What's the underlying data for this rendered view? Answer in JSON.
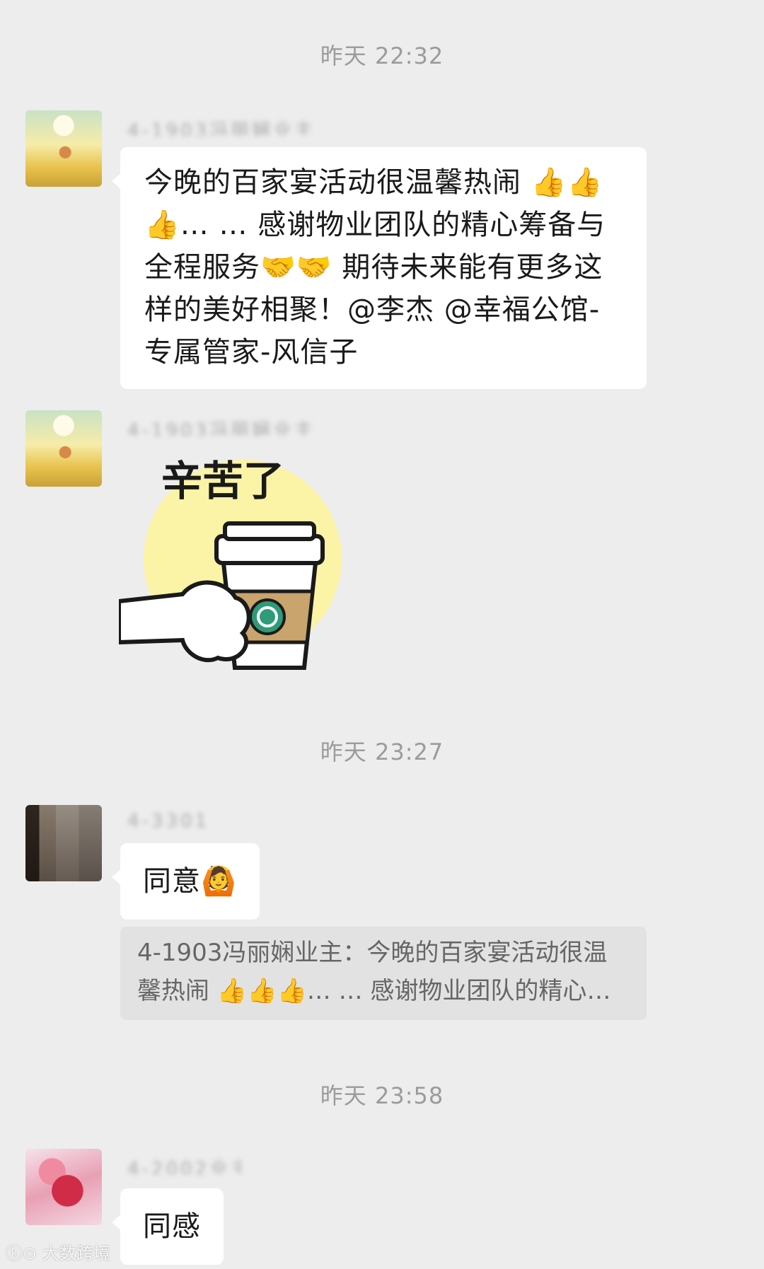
{
  "messages": [
    {
      "time": "昨天 22:32",
      "sender": "4-1903冯丽娴业主",
      "text": "今晚的百家宴活动很温馨热闹 👍👍👍… … 感谢物业团队的精心筹备与全程服务🤝🤝 期待未来能有更多这样的美好相聚！@李杰 @幸福公馆-专属管家-风信子"
    },
    {
      "sender": "4-1903冯丽娴业主",
      "sticker_text": "辛苦了"
    },
    {
      "time": "昨天 23:27",
      "sender": "4-3301",
      "text": "同意🙆",
      "quote": "4-1903冯丽娴业主：今晚的百家宴活动很温馨热闹 👍👍👍… … 感谢物业团队的精心筹备与全程服务🤝🤝 期待未来能有更多这样的美好相聚！"
    },
    {
      "time": "昨天 23:58",
      "sender": "4-2002业主",
      "text": "同感"
    }
  ],
  "watermark": "大数跨境"
}
